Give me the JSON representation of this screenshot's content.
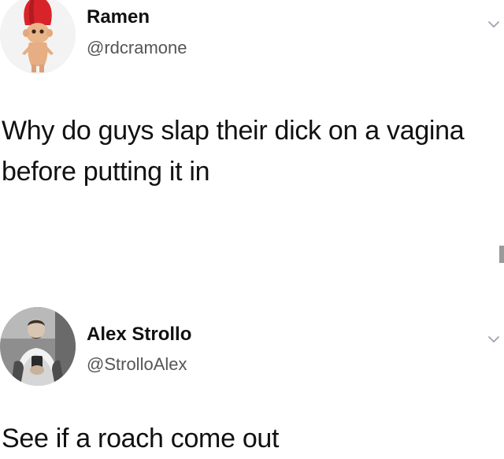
{
  "tweets": [
    {
      "display_name": "Ramen",
      "handle": "@rdcramone",
      "text": "Why do guys slap their dick on a vagina before putting it in",
      "avatar_icon": "troll-doll-avatar",
      "menu_icon": "chevron-down-icon"
    },
    {
      "display_name": "Alex Strollo",
      "handle": "@StrolloAlex",
      "text": "See if a roach come out",
      "avatar_icon": "profile-photo-avatar",
      "menu_icon": "chevron-down-icon"
    }
  ],
  "colors": {
    "background": "#ffffff",
    "text": "#111111",
    "handle": "#555555",
    "troll_hair": "#d8232a",
    "chevron": "#9aa5b1"
  }
}
